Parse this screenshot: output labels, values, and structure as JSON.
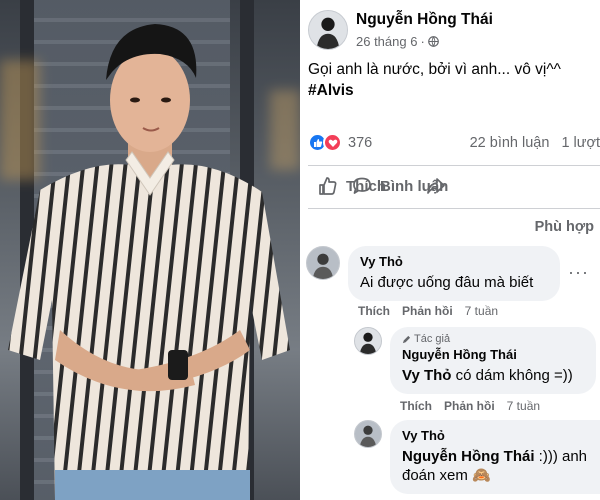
{
  "post": {
    "author_name": "Nguyễn Hồng Thái",
    "time": "26 tháng 6",
    "text_line1": "Gọi anh là nước, bởi vì anh... vô vị^^",
    "hashtag": "#Alvis",
    "reactions_count": "376",
    "comments_count": "22 bình luận",
    "shares_count": "1 lượt",
    "like_label": "Thích",
    "comment_label": "Bình luận",
    "sort_label": "Phù hợp"
  },
  "comments": [
    {
      "name": "Vy Thỏ",
      "text": "Ai được uống đâu mà biết",
      "like": "Thích",
      "reply": "Phản hồi",
      "time": "7 tuần"
    },
    {
      "badge": "Tác giả",
      "name": "Nguyễn Hồng Thái",
      "mention": "Vy Thỏ",
      "text": " có dám không =))",
      "like": "Thích",
      "reply": "Phản hồi",
      "time": "7 tuần"
    },
    {
      "name": "Vy Thỏ",
      "mention": "Nguyễn Hồng Thái",
      "text": " :))) anh",
      "text2": "đoán xem 🙈"
    }
  ],
  "colors": {
    "facebook_blue": "#1877f2",
    "love_red": "#f33e58",
    "secondary_text": "#65676b",
    "bubble_bg": "#f0f2f5"
  }
}
